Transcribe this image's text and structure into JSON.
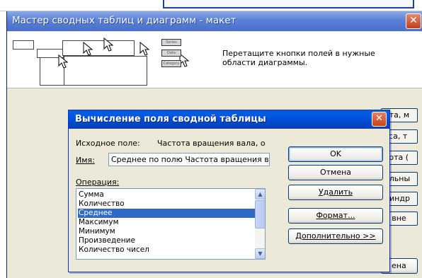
{
  "wizard": {
    "title": "Мастер сводных таблиц и диаграмм - макет",
    "close_glyph": "✕",
    "instructions_line1": "Перетащите кнопки полей в нужные",
    "instructions_line2": "области диаграммы.",
    "diagram_chips": [
      "Series",
      "Data",
      "Category"
    ],
    "side_buttons": [
      "ота, м",
      "сса, т",
      "тота (",
      "ельны",
      "линдр",
      "а вне",
      "ена"
    ]
  },
  "dialog": {
    "title": "Вычисление поля сводной таблицы",
    "close_glyph": "✕",
    "source_label": "Исходное поле:",
    "source_value": "Частота вращения вала, о",
    "name_label": "Имя:",
    "name_value": "Среднее по полю Частота вращения ва",
    "operation_label": "Операция:",
    "operations": [
      "Сумма",
      "Количество",
      "Среднее",
      "Максимум",
      "Минимум",
      "Произведение",
      "Количество чисел"
    ],
    "selected_operation": "Среднее",
    "buttons": {
      "ok": "OK",
      "cancel": "Отмена",
      "delete": "Удалить",
      "format": "Формат...",
      "more": "Дополнительно >>"
    }
  },
  "icons": {
    "scroll_up": "▲",
    "scroll_down": "▼"
  },
  "colors": {
    "selection": "#316ac5",
    "dialog_title": "#0055e5",
    "close_button": "#c7421a"
  }
}
